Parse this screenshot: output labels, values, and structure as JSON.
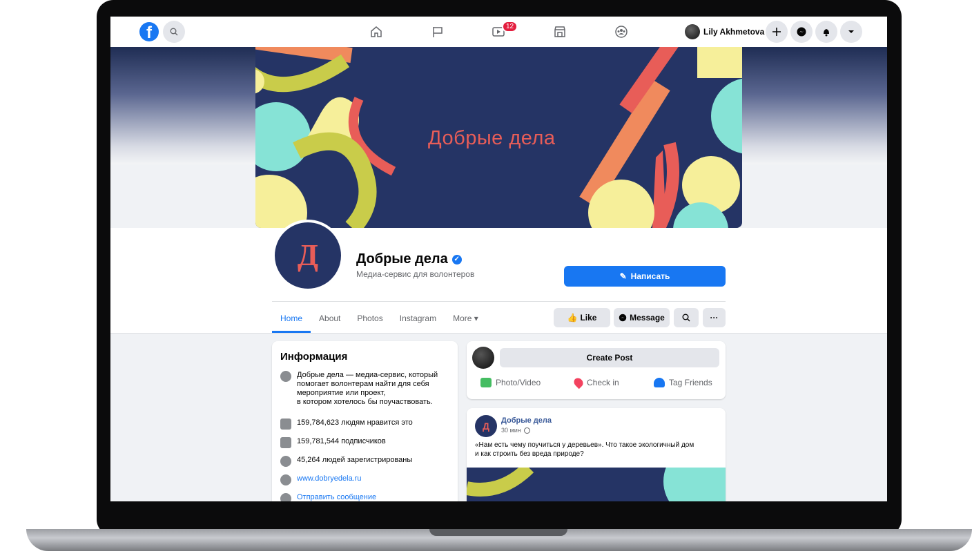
{
  "topbar": {
    "logo_letter": "f",
    "watch_badge": "12",
    "user_name": "Lily Akhmetova"
  },
  "cover": {
    "title": "Добрые дела"
  },
  "page": {
    "avatar_letter": "Д",
    "name": "Добрые дела",
    "subtitle": "Медиа-сервис для волонтеров",
    "write_button": "Написать"
  },
  "tabs": [
    "Home",
    "About",
    "Photos",
    "Instagram",
    "More"
  ],
  "actions": {
    "like": "Like",
    "message": "Message"
  },
  "info": {
    "title": "Информация",
    "description_lines": [
      "Добрые дела — медиа-сервис, который",
      "помогает волонтерам найти для себя",
      "мероприятие или проект,",
      "в котором хотелось бы поучаствовать."
    ],
    "likes": "159,784,623 людям нравится это",
    "followers": "159,781,544 подписчиков",
    "checkins": "45,264 людей зарегистрированы",
    "website": "www.dobryedela.ru",
    "send_message": "Отправить сообщение"
  },
  "create_post": {
    "button": "Create Post",
    "photo_video": "Photo/Video",
    "check_in": "Check in",
    "tag_friends": "Tag Friends"
  },
  "post": {
    "author": "Добрые дела",
    "time": "30 мин",
    "text_lines": [
      "«Нам есть чему поучиться у деревьев». Что такое экологичный дом",
      "и как строить без вреда природе?"
    ]
  },
  "colors": {
    "accent": "#1877f2",
    "cover_bg": "#253465",
    "cover_red": "#e85d58",
    "cover_yellow": "#f6ef9a",
    "cover_olive": "#c9cc4a",
    "cover_teal": "#86e3d6",
    "cover_orange": "#f08a5d",
    "badge": "#e41e3f"
  }
}
